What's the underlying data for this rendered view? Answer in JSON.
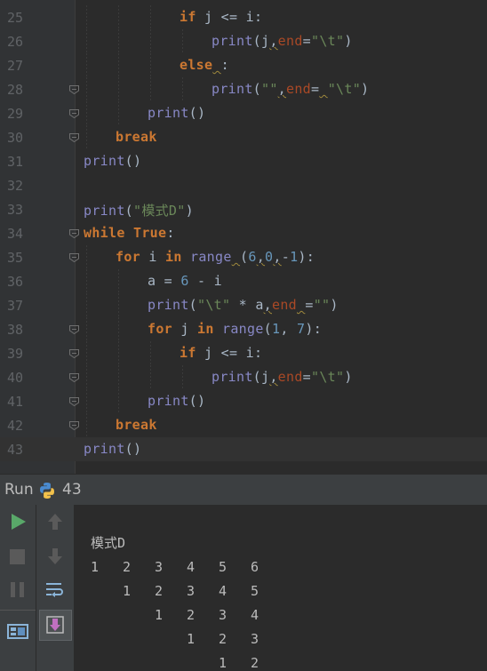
{
  "editor": {
    "lines": [
      {
        "num": "25",
        "indent": 3,
        "tokens": [
          [
            "k",
            "if"
          ],
          [
            "t",
            " j "
          ],
          [
            "t",
            "<="
          ],
          [
            "t",
            " i:"
          ]
        ]
      },
      {
        "num": "26",
        "indent": 4,
        "tokens": [
          [
            "f",
            "print"
          ],
          [
            "t",
            "(j"
          ],
          [
            "w",
            ","
          ],
          [
            "p",
            "end"
          ],
          [
            "t",
            "="
          ],
          [
            "s",
            "\"\\t\""
          ],
          [
            "t",
            ")"
          ]
        ]
      },
      {
        "num": "27",
        "indent": 3,
        "tokens": [
          [
            "k",
            "else"
          ],
          [
            "w",
            " "
          ],
          [
            "t",
            ":"
          ]
        ]
      },
      {
        "num": "28",
        "indent": 4,
        "fold": true,
        "tokens": [
          [
            "f",
            "print"
          ],
          [
            "t",
            "("
          ],
          [
            "s",
            "\"\""
          ],
          [
            "w",
            ","
          ],
          [
            "p",
            "end"
          ],
          [
            "t",
            "="
          ],
          [
            "w",
            " "
          ],
          [
            "s",
            "\"\\t\""
          ],
          [
            "t",
            ")"
          ]
        ]
      },
      {
        "num": "29",
        "indent": 2,
        "fold": true,
        "tokens": [
          [
            "f",
            "print"
          ],
          [
            "t",
            "()"
          ]
        ]
      },
      {
        "num": "30",
        "indent": 1,
        "fold": true,
        "tokens": [
          [
            "k",
            "break"
          ]
        ]
      },
      {
        "num": "31",
        "indent": 0,
        "tokens": [
          [
            "f",
            "print"
          ],
          [
            "t",
            "()"
          ]
        ]
      },
      {
        "num": "32",
        "indent": 0,
        "tokens": []
      },
      {
        "num": "33",
        "indent": 0,
        "tokens": [
          [
            "f",
            "print"
          ],
          [
            "t",
            "("
          ],
          [
            "s",
            "\"模式D\""
          ],
          [
            "t",
            ")"
          ]
        ]
      },
      {
        "num": "34",
        "indent": 0,
        "fold": true,
        "tokens": [
          [
            "k",
            "while"
          ],
          [
            "t",
            " "
          ],
          [
            "k",
            "True"
          ],
          [
            "t",
            ":"
          ]
        ]
      },
      {
        "num": "35",
        "indent": 1,
        "fold": true,
        "tokens": [
          [
            "k",
            "for"
          ],
          [
            "t",
            " i "
          ],
          [
            "k",
            "in"
          ],
          [
            "t",
            " "
          ],
          [
            "f",
            "range"
          ],
          [
            "w",
            " "
          ],
          [
            "t",
            "("
          ],
          [
            "n",
            "6"
          ],
          [
            "w",
            ","
          ],
          [
            "n",
            "0"
          ],
          [
            "w",
            ","
          ],
          [
            "t",
            "-"
          ],
          [
            "n",
            "1"
          ],
          [
            "t",
            "):"
          ]
        ]
      },
      {
        "num": "36",
        "indent": 2,
        "tokens": [
          [
            "t",
            "a = "
          ],
          [
            "n",
            "6"
          ],
          [
            "t",
            " - i"
          ]
        ]
      },
      {
        "num": "37",
        "indent": 2,
        "tokens": [
          [
            "f",
            "print"
          ],
          [
            "t",
            "("
          ],
          [
            "s",
            "\"\\t\""
          ],
          [
            "t",
            " * a"
          ],
          [
            "w",
            ","
          ],
          [
            "p",
            "end"
          ],
          [
            "w",
            " "
          ],
          [
            "t",
            "="
          ],
          [
            "s",
            "\"\""
          ],
          [
            "t",
            ")"
          ]
        ]
      },
      {
        "num": "38",
        "indent": 2,
        "fold": true,
        "tokens": [
          [
            "k",
            "for"
          ],
          [
            "t",
            " j "
          ],
          [
            "k",
            "in"
          ],
          [
            "t",
            " "
          ],
          [
            "f",
            "range"
          ],
          [
            "t",
            "("
          ],
          [
            "n",
            "1"
          ],
          [
            "t",
            ", "
          ],
          [
            "n",
            "7"
          ],
          [
            "t",
            "):"
          ]
        ]
      },
      {
        "num": "39",
        "indent": 3,
        "fold": true,
        "tokens": [
          [
            "k",
            "if"
          ],
          [
            "t",
            " j "
          ],
          [
            "t",
            "<="
          ],
          [
            "t",
            " i:"
          ]
        ]
      },
      {
        "num": "40",
        "indent": 4,
        "fold": true,
        "tokens": [
          [
            "f",
            "print"
          ],
          [
            "t",
            "(j"
          ],
          [
            "w",
            ","
          ],
          [
            "p",
            "end"
          ],
          [
            "t",
            "="
          ],
          [
            "s",
            "\"\\t\""
          ],
          [
            "t",
            ")"
          ]
        ]
      },
      {
        "num": "41",
        "indent": 2,
        "fold": true,
        "tokens": [
          [
            "f",
            "print"
          ],
          [
            "t",
            "()"
          ]
        ]
      },
      {
        "num": "42",
        "indent": 1,
        "fold": true,
        "tokens": [
          [
            "k",
            "break"
          ]
        ]
      },
      {
        "num": "43",
        "indent": 0,
        "current": true,
        "tokens": [
          [
            "f",
            "print"
          ],
          [
            "t",
            "()"
          ]
        ]
      }
    ]
  },
  "run_panel": {
    "title": "Run",
    "config_name": "43",
    "icons": [
      "run-icon",
      "stop-icon",
      "pause-icon",
      "layout-icon",
      "up-arrow-icon",
      "down-arrow-icon",
      "soft-wrap-icon",
      "scroll-to-end-icon"
    ]
  },
  "console": {
    "header": "模式D",
    "rows": [
      [
        "1",
        "2",
        "3",
        "4",
        "5",
        "6"
      ],
      [
        "",
        "1",
        "2",
        "3",
        "4",
        "5"
      ],
      [
        "",
        "",
        "1",
        "2",
        "3",
        "4"
      ],
      [
        "",
        "",
        "",
        "1",
        "2",
        "3"
      ],
      [
        "",
        "",
        "",
        "",
        "1",
        "2"
      ]
    ]
  },
  "colors": {
    "keyword": "#cc7832",
    "builtin": "#8888c6",
    "string": "#6a8759",
    "number": "#6897bb",
    "param": "#aa4926",
    "text": "#a9b7c6",
    "run_green": "#59a869"
  }
}
